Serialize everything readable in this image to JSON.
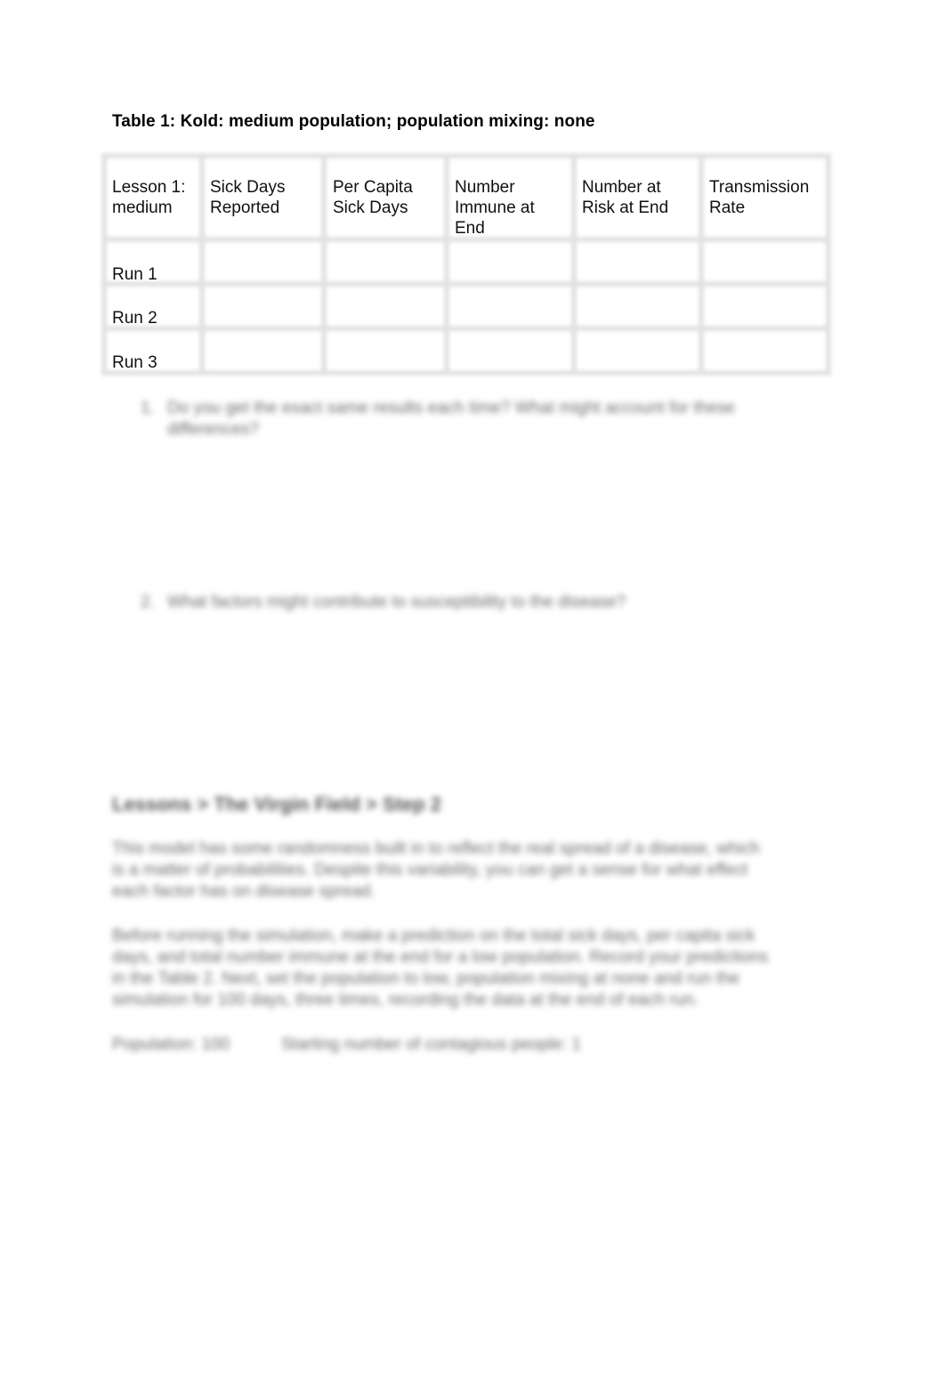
{
  "document": {
    "table1": {
      "title": "Table 1: Kold: medium population; population mixing: none",
      "header_line1": [
        "Lesson 1:",
        "Sick Days",
        "Per Capita",
        "Number",
        "Number at",
        "Transmission"
      ],
      "header_line2": [
        "medium",
        "Reported",
        "Sick Days",
        "Immune at",
        "Risk at End",
        "Rate"
      ],
      "header_line3": [
        "",
        "",
        "",
        "End",
        "",
        ""
      ],
      "rows": [
        {
          "label": "Run 1",
          "values": [
            "",
            "",
            "",
            "",
            ""
          ]
        },
        {
          "label": "Run 2",
          "values": [
            "",
            "",
            "",
            "",
            ""
          ]
        },
        {
          "label": "Run 3",
          "values": [
            "",
            "",
            "",
            "",
            ""
          ]
        }
      ]
    },
    "questions": [
      {
        "number": "1.",
        "line1": "Do you get the exact same results each time? What might account for these",
        "line2": "differences?"
      },
      {
        "number": "2.",
        "number_alt": "2.",
        "line1": "What factors might contribute to susceptibility to the disease?"
      }
    ],
    "section": {
      "heading": "Lessons > The Virgin Field > Step 2",
      "paragraph1": [
        "This model has some randomness built in to reflect the real spread of a disease, which",
        "is a matter of probabilities. Despite this variability, you can get a sense for what effect",
        "each factor has on disease spread."
      ],
      "paragraph2": [
        "Before running the simulation, make a prediction on the total sick days, per capita sick",
        "days, and total number immune at the end for a low population. Record your predictions",
        "in the Table 2. Next, set the population to low, population mixing at none and run the",
        "simulation for 100 days, three times, recording the data at the end of each run."
      ],
      "settings": {
        "population": "Population: 100",
        "contagious": "Starting number of contagious people: 1"
      }
    }
  }
}
